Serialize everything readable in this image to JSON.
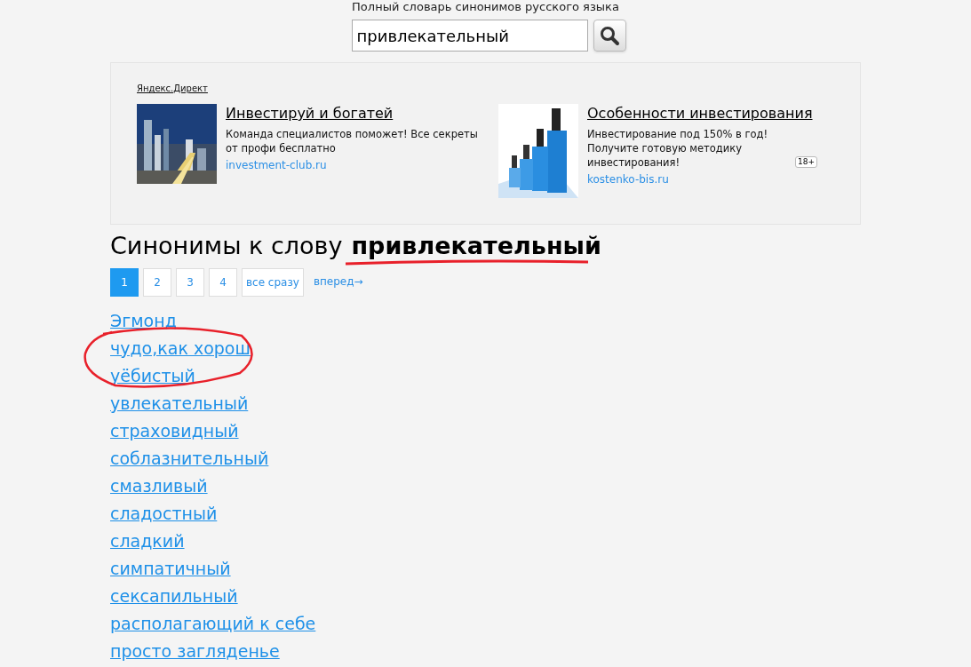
{
  "site_subtitle": "Полный словарь синонимов русского языка",
  "search": {
    "value": "привлекательный"
  },
  "ads": {
    "label": "Яндекс.Директ",
    "items": [
      {
        "title": "Инвестируй и богатей",
        "text": "Команда специалистов поможет! Все секреты от профи бесплатно",
        "domain": "investment-club.ru",
        "kind": "picture"
      },
      {
        "title": "Особенности инвестирования",
        "text": "Инвестирование под 150% в год! Получите готовую методику инвестирования!",
        "age_badge": "18+",
        "domain": "kostenko-bis.ru",
        "kind": "picture"
      }
    ]
  },
  "heading": {
    "prefix": "Синонимы к слову",
    "word": "привлекательный"
  },
  "pagination": [
    {
      "label": "1",
      "selected": true
    },
    {
      "label": "2",
      "selected": false
    },
    {
      "label": "3",
      "selected": false
    },
    {
      "label": "4",
      "selected": false
    },
    {
      "label": "все сразу",
      "selected": false
    }
  ],
  "next_link": "вперед→",
  "synonyms": [
    "Эгмонд",
    "чудо,как хорош",
    "уёбистый",
    "увлекательный",
    "страховидный",
    "соблазнительный",
    "смазливый",
    "сладостный",
    "сладкий",
    "симпатичный",
    "сексапильный",
    "располагающий к себе",
    "просто загляденье"
  ]
}
